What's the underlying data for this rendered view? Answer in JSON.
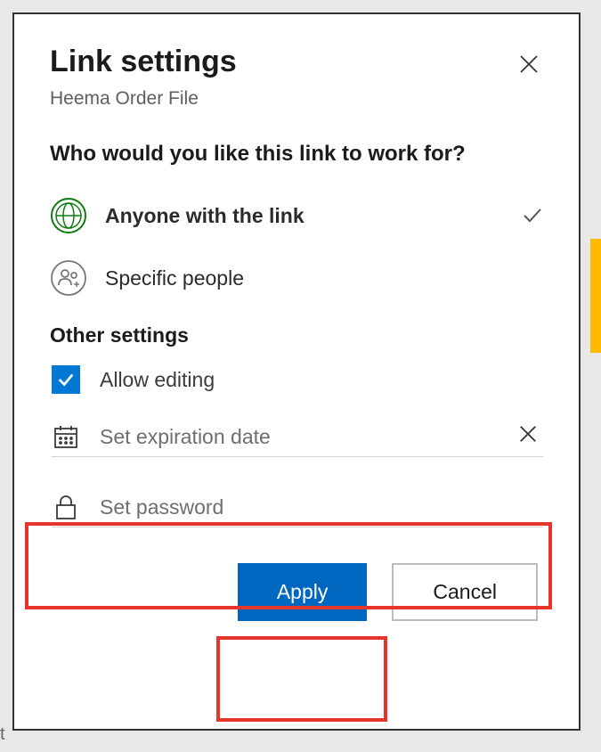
{
  "dialog": {
    "title": "Link settings",
    "subtitle": "Heema Order File",
    "prompt": "Who would you like this link to work for?"
  },
  "options": {
    "anyone": "Anyone with the link",
    "specific": "Specific people"
  },
  "other_settings": {
    "header": "Other settings",
    "allow_editing": "Allow editing",
    "expiration_placeholder": "Set expiration date",
    "password_placeholder": "Set password"
  },
  "buttons": {
    "apply": "Apply",
    "cancel": "Cancel"
  },
  "colors": {
    "primary": "#0067c0",
    "highlight": "#e6352a",
    "globe": "#107c10"
  }
}
